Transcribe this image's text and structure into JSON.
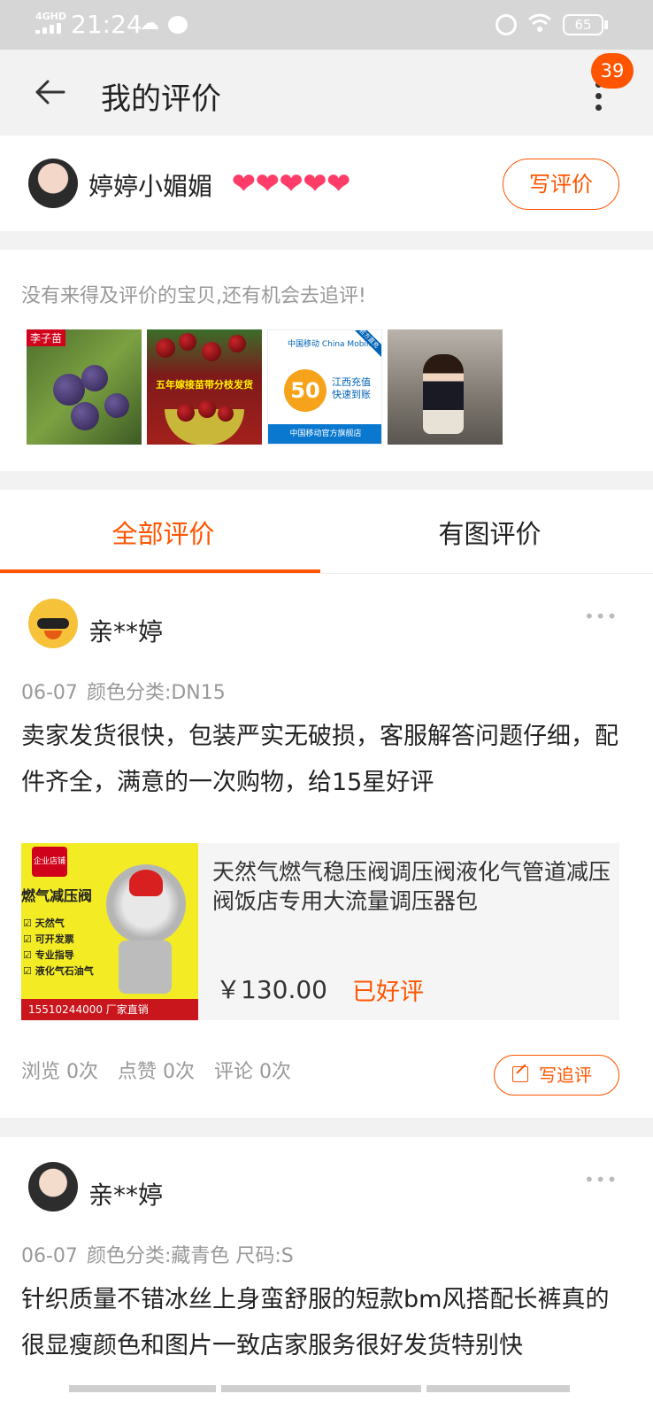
{
  "status_bar": {
    "network": "4GHD",
    "time": "21:24",
    "battery": "65"
  },
  "nav": {
    "title": "我的评价",
    "notification_count": "39"
  },
  "user": {
    "name": "婷婷小媚媚",
    "level_hearts": 5,
    "write_review_label": "写评价"
  },
  "pending": {
    "hint": "没有来得及评价的宝贝,还有机会去追评!",
    "items": [
      {
        "icon": "plum-product-thumbnail",
        "label": "李子苗"
      },
      {
        "icon": "cherry-product-thumbnail",
        "label": "五年嫁接苗带分枝发货"
      },
      {
        "icon": "china-mobile-recharge-thumbnail",
        "label": "中国移动官方旗舰店",
        "amount": "50",
        "text": "江西充值 快速到账",
        "brand": "中国移动 China Mobile",
        "corner": "官方直充"
      },
      {
        "icon": "fashion-photo-thumbnail",
        "label": ""
      }
    ]
  },
  "tabs": [
    {
      "label": "全部评价",
      "active": true
    },
    {
      "label": "有图评价",
      "active": false
    }
  ],
  "reviews": [
    {
      "user": "亲**婷",
      "date": "06-07",
      "spec": "颜色分类:DN15",
      "text": "卖家发货很快，包装严实无破损，客服解答问题仔细，配件齐全，满意的一次购物，给15星好评",
      "product": {
        "title": "天然气燃气稳压阀调压阀液化气管道减压阀饭店专用大流量调压器包",
        "price": "￥130.00",
        "status": "已好评",
        "image_badge": "企业店铺",
        "image_heading": "燃气减压阀",
        "image_bullets": [
          "天然气",
          "可开发票",
          "专业指导",
          "液化气石油气"
        ],
        "image_footer": "15510244000  厂家直销"
      },
      "stats": {
        "views": "浏览 0次",
        "likes": "点赞 0次",
        "comments": "评论 0次"
      },
      "followup_label": "写追评"
    },
    {
      "user": "亲**婷",
      "date": "06-07",
      "spec": "颜色分类:藏青色 尺码:S",
      "text": "针织质量不错冰丝上身蛮舒服的短款bm风搭配长裤真的很显瘦颜色和图片一致店家服务很好发货特别快"
    }
  ],
  "colors": {
    "accent": "#ff5500",
    "muted_text": "#999999",
    "background": "#f2f2f2"
  }
}
